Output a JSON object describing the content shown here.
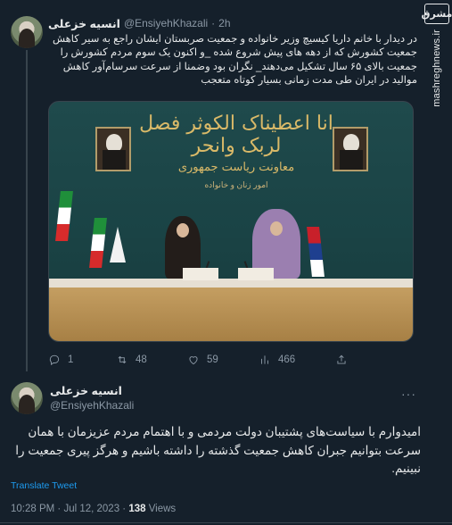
{
  "watermark": {
    "logo": "مشرق",
    "site": "mashreghnews.ir"
  },
  "tweet1": {
    "author_name": "انسیه خزعلی",
    "handle": "@EnsiyehKhazali",
    "dot": "·",
    "time": "2h",
    "text": "در دیدار با خانم داریا کیسیچ وزیر خانواده و جمعیت صربستان ایشان راجع به سیر کاهش جمعیت کشورش که از دهه های پیش شروع شده _و اکنون یک سوم مردم کشورش را جمعیت بالای ۶۵ سال تشکیل می‌دهند_ نگران بود وضمنا از سرعت سرسام‌آور کاهش موالید در ایران طی مدت زمانی بسیار کوتاه متعجب",
    "photo": {
      "banner_calligraphy": "انا اعطیناک الکوثر فصل لربک وانحر",
      "sign_title": "معاونت ریاست جمهوری",
      "sign_subtitle": "امور زنان و خانواده"
    },
    "actions": {
      "replies": "1",
      "retweets": "48",
      "likes": "59",
      "views": "466"
    }
  },
  "tweet2": {
    "author_name": "انسیه خزعلی",
    "handle": "@EnsiyehKhazali",
    "more": "···",
    "text": "امیدوارم با سیاست‌های پشتیبان دولت مردمی و با اهتمام مردم عزیزمان با همان سرعت بتوانیم جبران کاهش جمعیت گذشته را داشته باشیم و هرگز پیری جمعیت را نبینیم.",
    "translate_label": "Translate Tweet",
    "timestamp": "10:28 PM · Jul 12, 2023 · ",
    "views_count": "138",
    "views_label": " Views"
  },
  "icons": {
    "reply": "reply-icon",
    "retweet": "retweet-icon",
    "like": "heart-icon",
    "views": "views-chart-icon",
    "share": "share-icon"
  }
}
